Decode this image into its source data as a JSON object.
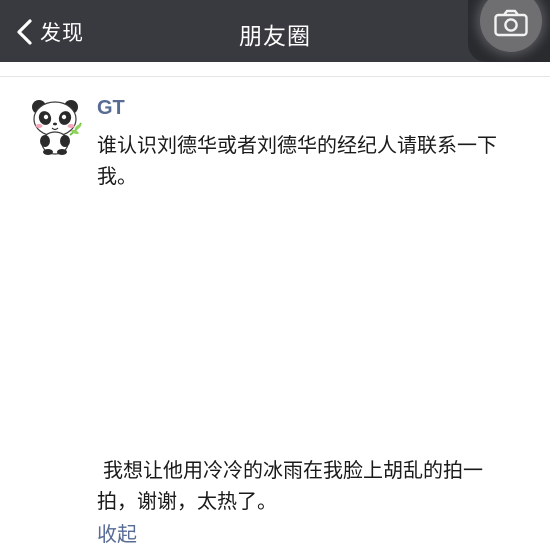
{
  "navbar": {
    "back_label": "发现",
    "title": "朋友圈",
    "background_color": "#393a3f"
  },
  "post": {
    "username": "GT",
    "text": "谁认识刘德华或者刘德华的经纪人请联系一下我。",
    "avatar_icon": "panda-avatar-icon",
    "comment_text": "我想让他用冷冷的冰雨在我脸上胡乱的拍一拍，谢谢，太热了。",
    "collapse_label": "收起",
    "link_color": "#576b95"
  }
}
